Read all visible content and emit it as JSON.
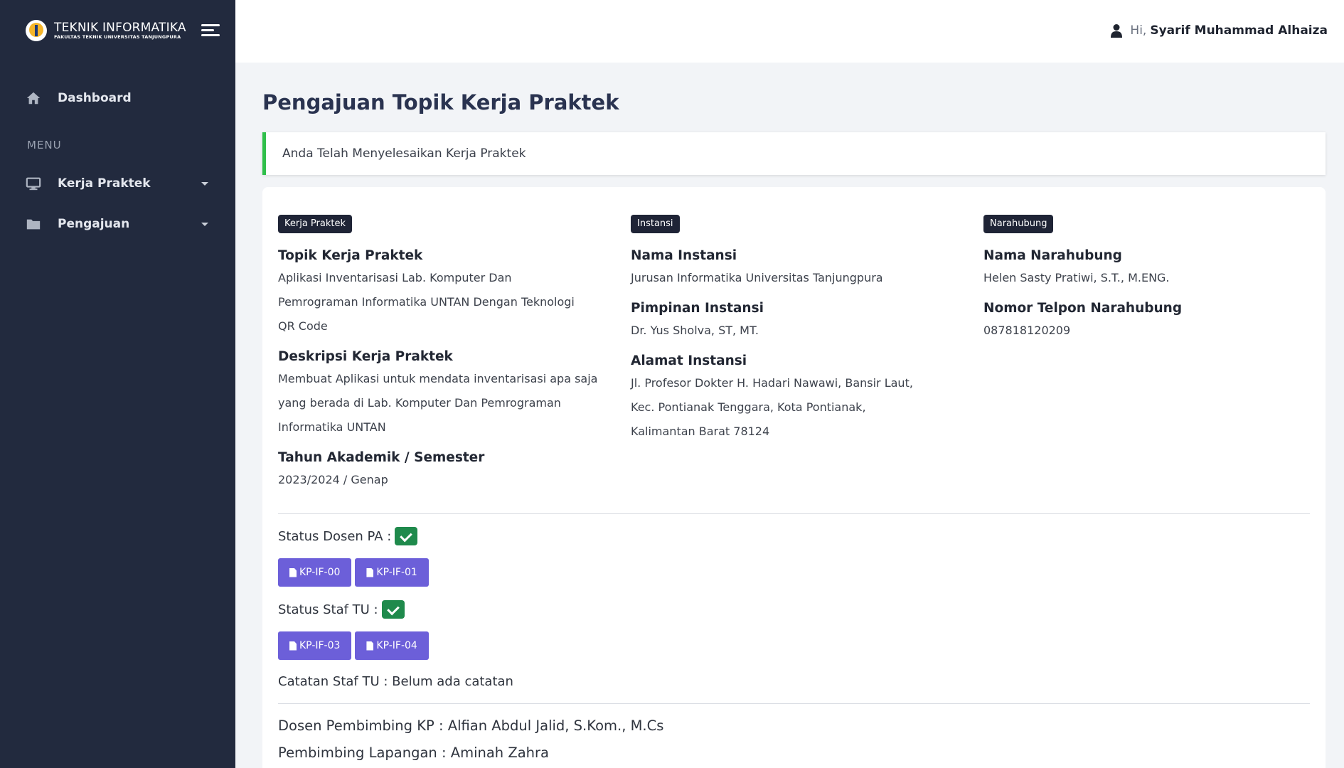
{
  "brand": {
    "title": "TEKNIK INFORMATIKA",
    "subtitle": "FAKULTAS TEKNIK UNIVERSITAS TANJUNGPURA"
  },
  "sidebar": {
    "dashboard_label": "Dashboard",
    "menu_heading": "MENU",
    "items": [
      {
        "label": "Kerja Praktek",
        "icon": "monitor-icon"
      },
      {
        "label": "Pengajuan",
        "icon": "folder-icon"
      }
    ]
  },
  "header": {
    "greeting": "Hi,",
    "user_name": "Syarif Muhammad Alhaiza"
  },
  "page": {
    "title": "Pengajuan Topik Kerja Praktek",
    "alert": "Anda Telah Menyelesaikan Kerja Praktek"
  },
  "kerja_praktek": {
    "badge": "Kerja Praktek",
    "topik_label": "Topik Kerja Praktek",
    "topik_value": "Aplikasi Inventarisasi Lab. Komputer Dan Pemrograman Informatika UNTAN Dengan Teknologi QR Code",
    "deskripsi_label": "Deskripsi Kerja Praktek",
    "deskripsi_value": "Membuat Aplikasi untuk mendata inventarisasi apa saja yang berada di Lab. Komputer Dan Pemrograman Informatika UNTAN",
    "tahun_label": "Tahun Akademik / Semester",
    "tahun_value": "2023/2024 / Genap"
  },
  "instansi": {
    "badge": "Instansi",
    "nama_label": "Nama Instansi",
    "nama_value": "Jurusan Informatika Universitas Tanjungpura",
    "pimpinan_label": "Pimpinan Instansi",
    "pimpinan_value": "Dr. Yus Sholva, ST, MT.",
    "alamat_label": "Alamat Instansi",
    "alamat_value": "Jl. Profesor Dokter H. Hadari Nawawi, Bansir Laut, Kec. Pontianak Tenggara, Kota Pontianak, Kalimantan Barat 78124"
  },
  "narahubung": {
    "badge": "Narahubung",
    "nama_label": "Nama Narahubung",
    "nama_value": "Helen Sasty Pratiwi, S.T., M.ENG.",
    "telp_label": "Nomor Telpon Narahubung",
    "telp_value": "087818120209"
  },
  "status": {
    "dosen_pa_label": "Status Dosen PA :",
    "dosen_pa_docs": [
      "KP-IF-00",
      "KP-IF-01"
    ],
    "staf_tu_label": "Status Staf TU :",
    "staf_tu_docs": [
      "KP-IF-03",
      "KP-IF-04"
    ],
    "catatan": "Catatan Staf TU : Belum ada catatan"
  },
  "pembimbing": {
    "dosen": "Dosen Pembimbing KP : Alfian Abdul Jalid, S.Kom., M.Cs",
    "lapangan": "Pembimbing Lapangan : Aminah Zahra"
  },
  "colors": {
    "sidebar_bg": "#222a3e",
    "accent_button": "#6c5fd9",
    "success": "#1f8a4c",
    "alert_border": "#2fbf4a"
  }
}
